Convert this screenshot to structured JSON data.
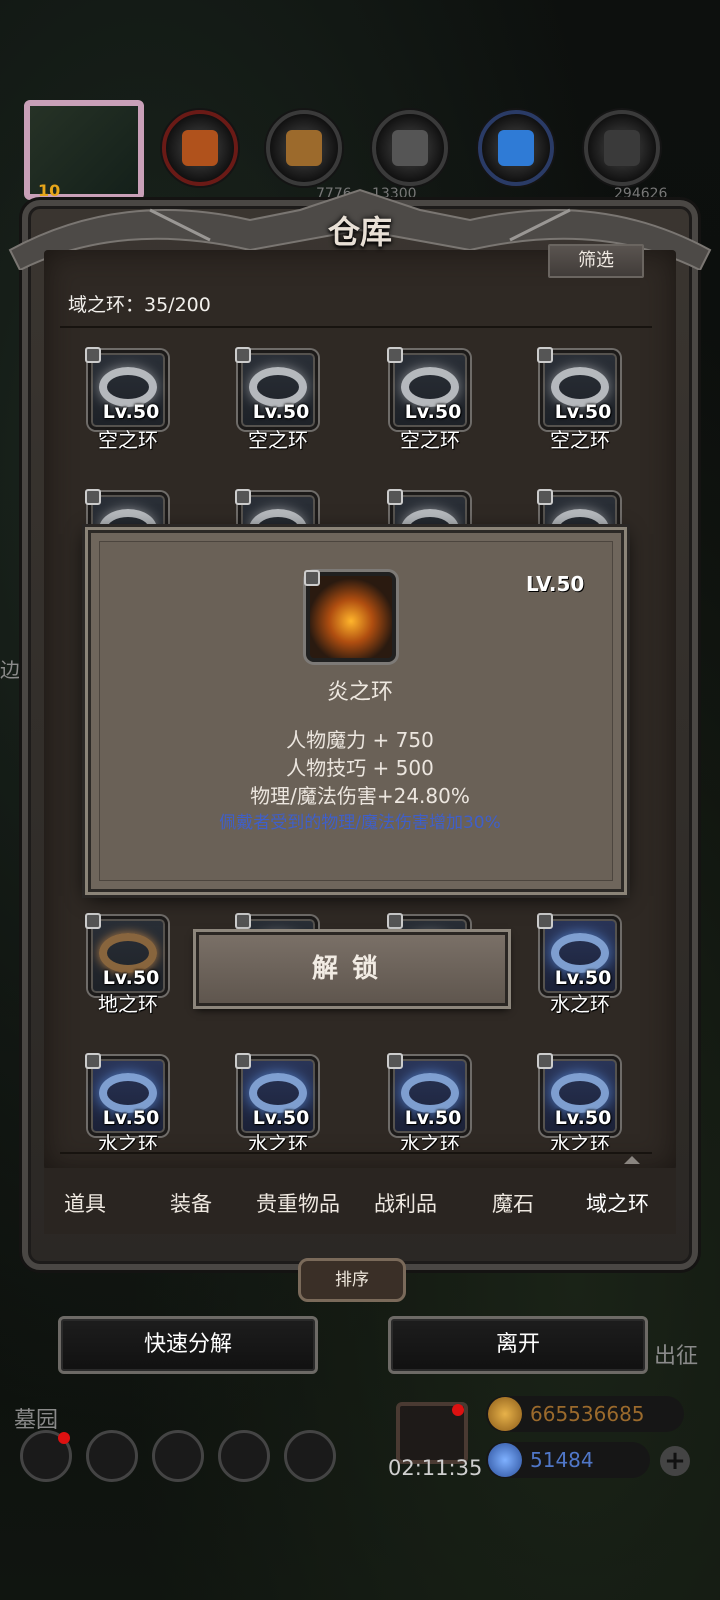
{
  "header": {
    "title": "仓库",
    "filter_label": "筛选",
    "portrait_level": "10"
  },
  "resources": [
    "7776",
    "13300",
    "",
    "",
    "",
    "294626"
  ],
  "inventory": {
    "count_label": "域之环：35/200",
    "rows": [
      [
        {
          "level": "Lv.50",
          "name": "空之环",
          "kind": "sky"
        },
        {
          "level": "Lv.50",
          "name": "空之环",
          "kind": "sky"
        },
        {
          "level": "Lv.50",
          "name": "空之环",
          "kind": "sky"
        },
        {
          "level": "Lv.50",
          "name": "空之环",
          "kind": "sky"
        }
      ],
      [
        {
          "level": "Lv.50",
          "name": "地之环",
          "kind": "earth"
        },
        {
          "level": "",
          "name": "",
          "kind": "hidden"
        },
        {
          "level": "",
          "name": "",
          "kind": "hidden"
        },
        {
          "level": "Lv.50",
          "name": "水之环",
          "kind": "water"
        }
      ],
      [
        {
          "level": "Lv.50",
          "name": "水之环",
          "kind": "water"
        },
        {
          "level": "Lv.50",
          "name": "水之环",
          "kind": "water"
        },
        {
          "level": "Lv.50",
          "name": "水之环",
          "kind": "water"
        },
        {
          "level": "Lv.50",
          "name": "水之环",
          "kind": "water"
        }
      ]
    ]
  },
  "tooltip": {
    "level": "LV.50",
    "name": "炎之环",
    "stats": [
      "人物魔力 + 750",
      "人物技巧 + 500",
      "物理/魔法伤害+24.80%"
    ],
    "effect": "佩戴者受到的物理/魔法伤害增加30%"
  },
  "unlock_label": "解锁",
  "tabs": [
    "道具",
    "装备",
    "贵重物品",
    "战利品",
    "魔石",
    "域之环"
  ],
  "active_tab": "域之环",
  "sort_label": "排序",
  "buttons": {
    "quick_decompose": "快速分解",
    "leave": "离开"
  },
  "side_labels": {
    "left": "墓园",
    "right": "出征",
    "left_mid": "边"
  },
  "bottom_bar": {
    "timer": "02:11:35",
    "gold": "665536685",
    "gems": "51484",
    "plus_label": "+"
  },
  "colors": {
    "gold_text": "#9b6a2c",
    "gem_text": "#5077c8",
    "effect_text": "#3f5fc9"
  }
}
